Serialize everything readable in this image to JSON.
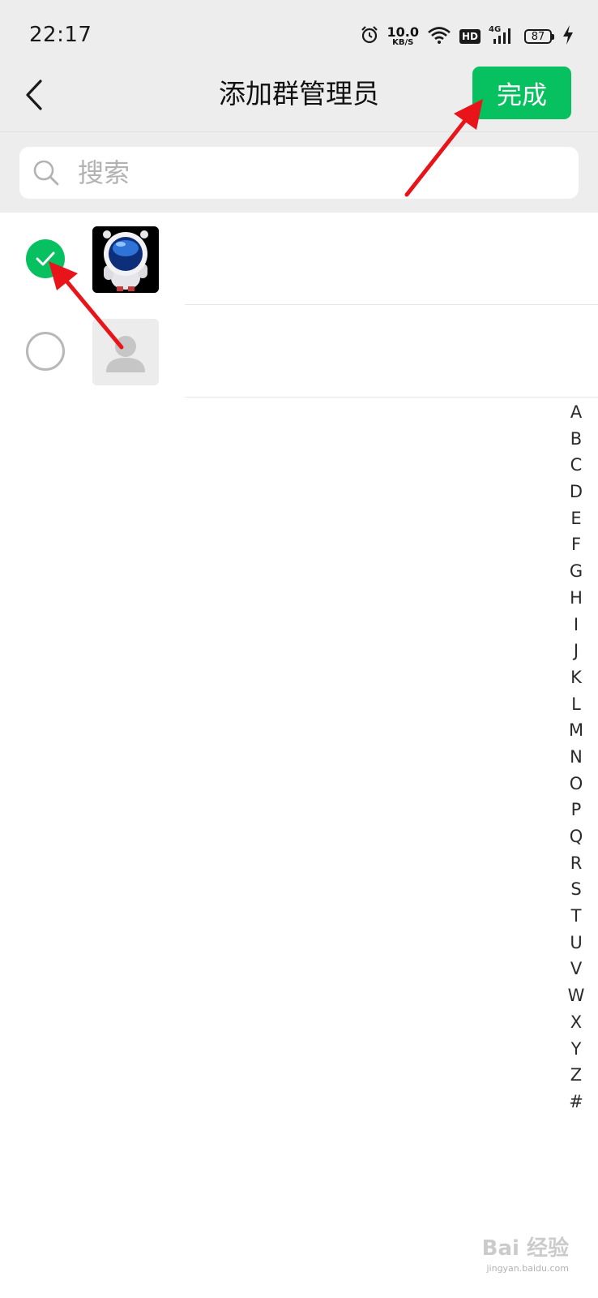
{
  "status_bar": {
    "time": "22:17",
    "network_speed": "10.0",
    "network_speed_unit": "KB/S",
    "hd_label": "HD",
    "network_type": "4G",
    "battery": "87",
    "icons": [
      "alarm-icon",
      "wifi-icon",
      "hd-icon",
      "cell-signal-icon",
      "battery-icon",
      "charging-icon"
    ]
  },
  "header": {
    "title": "添加群管理员",
    "done_label": "完成",
    "back_icon": "chevron-left-icon"
  },
  "search": {
    "placeholder": "搜索",
    "icon": "search-icon"
  },
  "members": [
    {
      "selected": true,
      "avatar": "astronaut-avatar"
    },
    {
      "selected": false,
      "avatar": "default-person-avatar"
    }
  ],
  "index_bar": [
    "A",
    "B",
    "C",
    "D",
    "E",
    "F",
    "G",
    "H",
    "I",
    "J",
    "K",
    "L",
    "M",
    "N",
    "O",
    "P",
    "Q",
    "R",
    "S",
    "T",
    "U",
    "V",
    "W",
    "X",
    "Y",
    "Z",
    "#"
  ],
  "watermark": {
    "text": "Bai 经验",
    "url": "jingyan.baidu.com"
  },
  "colors": {
    "accent": "#07c160",
    "header_bg": "#ededed",
    "annotation_arrow": "#e8141a"
  }
}
